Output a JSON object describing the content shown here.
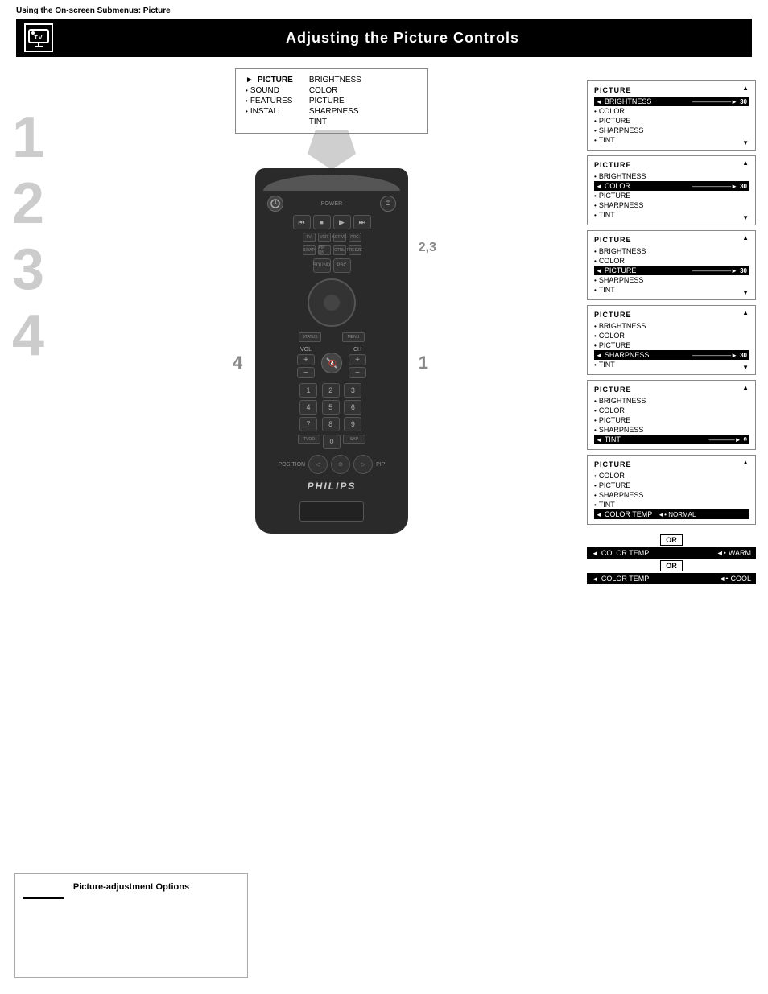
{
  "header": {
    "subtitle": "Using the On-screen Submenus: Picture",
    "title": "Adjusting the Picture Controls"
  },
  "osd_main": {
    "left_items": [
      {
        "bullet": "►",
        "label": "PICTURE",
        "selected": true
      },
      {
        "bullet": "•",
        "label": "SOUND"
      },
      {
        "bullet": "•",
        "label": "FEATURES"
      },
      {
        "bullet": "•",
        "label": "INSTALL"
      }
    ],
    "right_items": [
      {
        "label": "BRIGHTNESS"
      },
      {
        "label": "COLOR"
      },
      {
        "label": "PICTURE"
      },
      {
        "label": "SHARPNESS"
      },
      {
        "label": "TINT"
      }
    ]
  },
  "step_numbers": [
    "1",
    "2",
    "3",
    "4"
  ],
  "remote": {
    "brand": "PHILIPS",
    "step_labels": {
      "s23": "2,3",
      "s4": "4",
      "s1": "1"
    }
  },
  "picture_menus": [
    {
      "id": "menu1",
      "title": "PICTURE",
      "items": [
        {
          "bullet": "◄",
          "label": "BRIGHTNESS",
          "active": true,
          "slider": true,
          "value": "30"
        },
        {
          "bullet": "•",
          "label": "COLOR"
        },
        {
          "bullet": "•",
          "label": "PICTURE"
        },
        {
          "bullet": "•",
          "label": "SHARPNESS"
        },
        {
          "bullet": "•",
          "label": "TINT"
        }
      ]
    },
    {
      "id": "menu2",
      "title": "PICTURE",
      "items": [
        {
          "bullet": "•",
          "label": "BRIGHTNESS"
        },
        {
          "bullet": "◄",
          "label": "COLOR",
          "active": true,
          "slider": true,
          "value": "30"
        },
        {
          "bullet": "•",
          "label": "PICTURE"
        },
        {
          "bullet": "•",
          "label": "SHARPNESS"
        },
        {
          "bullet": "•",
          "label": "TINT"
        }
      ]
    },
    {
      "id": "menu3",
      "title": "PICTURE",
      "items": [
        {
          "bullet": "•",
          "label": "BRIGHTNESS"
        },
        {
          "bullet": "•",
          "label": "COLOR"
        },
        {
          "bullet": "◄",
          "label": "PICTURE",
          "active": true,
          "slider": true,
          "value": "30"
        },
        {
          "bullet": "•",
          "label": "SHARPNESS"
        },
        {
          "bullet": "•",
          "label": "TINT"
        }
      ]
    },
    {
      "id": "menu4",
      "title": "PICTURE",
      "items": [
        {
          "bullet": "•",
          "label": "BRIGHTNESS"
        },
        {
          "bullet": "•",
          "label": "COLOR"
        },
        {
          "bullet": "•",
          "label": "PICTURE"
        },
        {
          "bullet": "◄",
          "label": "SHARPNESS",
          "active": true,
          "slider": true,
          "value": "30"
        },
        {
          "bullet": "•",
          "label": "TINT"
        }
      ]
    },
    {
      "id": "menu5",
      "title": "PICTURE",
      "items": [
        {
          "bullet": "•",
          "label": "BRIGHTNESS"
        },
        {
          "bullet": "•",
          "label": "COLOR"
        },
        {
          "bullet": "•",
          "label": "PICTURE"
        },
        {
          "bullet": "•",
          "label": "SHARPNESS"
        },
        {
          "bullet": "◄",
          "label": "TINT",
          "active": true,
          "slider": true,
          "value": "0"
        }
      ]
    },
    {
      "id": "menu6",
      "title": "PICTURE",
      "items": [
        {
          "bullet": "•",
          "label": "COLOR"
        },
        {
          "bullet": "•",
          "label": "PICTURE"
        },
        {
          "bullet": "•",
          "label": "SHARPNESS"
        },
        {
          "bullet": "•",
          "label": "TINT"
        },
        {
          "bullet": "◄",
          "label": "COLOR TEMP",
          "active": true,
          "option": "NORMAL"
        }
      ]
    }
  ],
  "color_temp_options": [
    {
      "label": "COLOR TEMP",
      "value": "NORMAL"
    },
    {
      "label": "COLOR TEMP",
      "value": "WARM"
    },
    {
      "label": "COLOR TEMP",
      "value": "COOL"
    }
  ],
  "bottom_box": {
    "title": "Picture-adjustment Options"
  }
}
